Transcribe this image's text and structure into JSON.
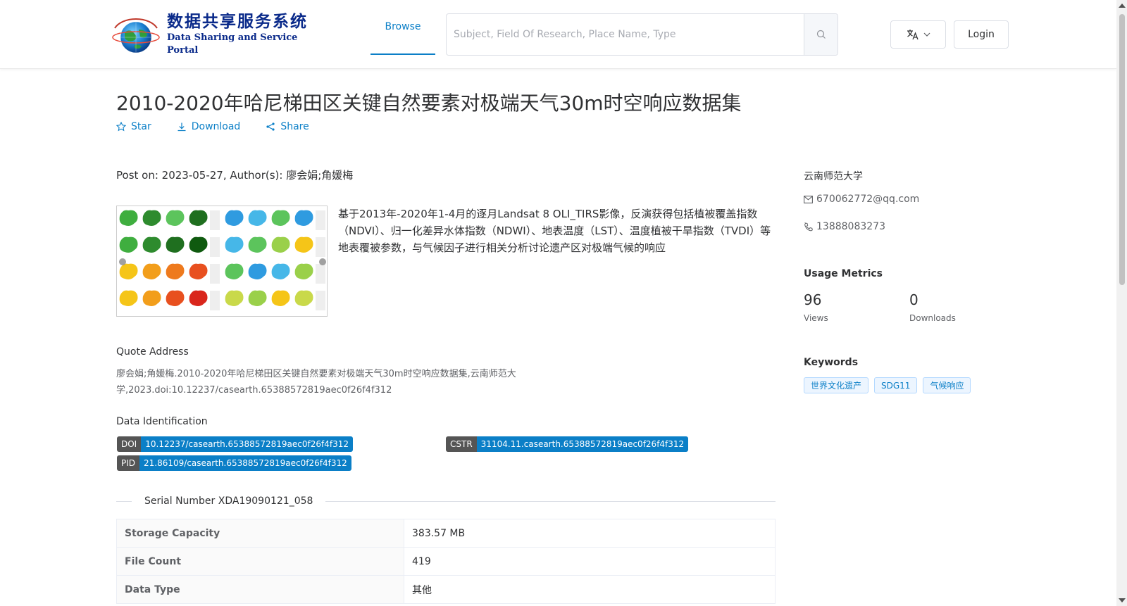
{
  "header": {
    "logo_cn": "数据共享服务系统",
    "logo_en": "Data Sharing and Service Portal",
    "nav_browse": "Browse",
    "search_placeholder": "Subject, Field Of Research, Place Name, Type",
    "login": "Login"
  },
  "dataset": {
    "title": "2010-2020年哈尼梯田区关键自然要素对极端天气30m时空响应数据集",
    "actions": {
      "star": "Star",
      "download": "Download",
      "share": "Share"
    },
    "post_info": "Post on: 2023-05-27, Author(s): 廖会娟;角媛梅",
    "description": "基于2013年-2020年1-4月的逐月Landsat 8 OLI_TIRS影像，反演获得包括植被覆盖指数（NDVI）、归一化差异水体指数（NDWI）、地表温度（LST）、温度植被干旱指数（TVDI）等地表覆被参数，与气候因子进行相关分析讨论遗产区对极端气候的响应",
    "quote_label": "Quote Address",
    "quote_text": "廖会娟;角媛梅.2010-2020年哈尼梯田区关键自然要素对极端天气30m时空响应数据集,云南师范大学,2023.doi:10.12237/casearth.65388572819aec0f26f4f312",
    "identification_label": "Data Identification",
    "ids": {
      "doi_k": "DOI",
      "doi_v": "10.12237/casearth.65388572819aec0f26f4f312",
      "cstr_k": "CSTR",
      "cstr_v": "31104.11.casearth.65388572819aec0f26f4f312",
      "pid_k": "PID",
      "pid_v": "21.86109/casearth.65388572819aec0f26f4f312"
    },
    "serial": "Serial Number XDA19090121_058",
    "specs": [
      {
        "k": "Storage Capacity",
        "v": "383.57 MB"
      },
      {
        "k": "File Count",
        "v": "419"
      },
      {
        "k": "Data Type",
        "v": "其他"
      }
    ]
  },
  "sidebar": {
    "org": "云南师范大学",
    "email": "670062772@qq.com",
    "phone": "13888083273",
    "metrics_title": "Usage Metrics",
    "views": "96",
    "views_label": "Views",
    "downloads": "0",
    "downloads_label": "Downloads",
    "keywords_title": "Keywords",
    "keywords": [
      "世界文化遗产",
      "SDG11",
      "气候响应"
    ]
  },
  "colors": {
    "accent": "#0b7fc7",
    "tag_key": "#555555"
  }
}
